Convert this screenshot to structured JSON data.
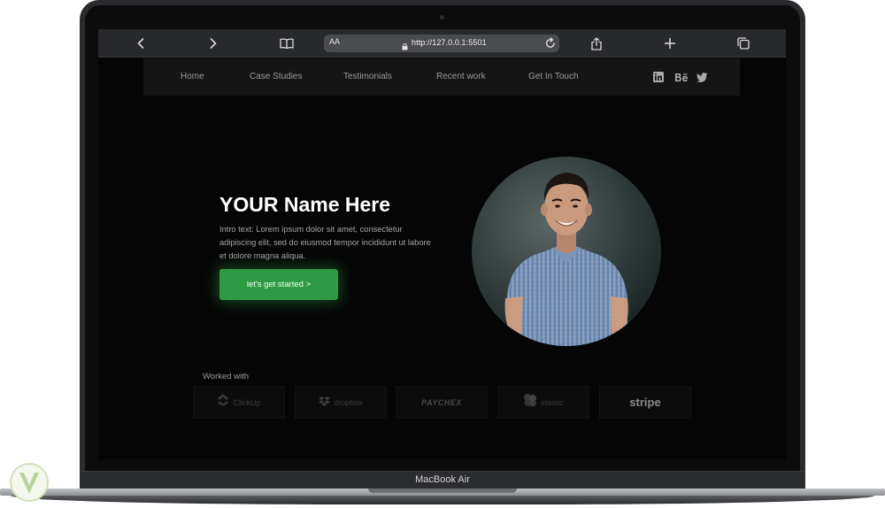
{
  "browser": {
    "url": "http://127.0.0.1:5501",
    "text_size_label": "AA",
    "icons": [
      "chevron-left-icon",
      "chevron-right-icon",
      "book-icon",
      "lock-icon",
      "reload-icon",
      "share-icon",
      "plus-icon",
      "tabs-icon"
    ]
  },
  "nav": {
    "links": [
      "Home",
      "Case Studies",
      "Testimonials",
      "Recent work",
      "Get In Touch"
    ],
    "social_icons": [
      "linkedin-icon",
      "behance-icon",
      "twitter-icon"
    ]
  },
  "hero": {
    "title": "YOUR Name Here",
    "intro": "Intro text: Lorem ipsum dolor sit amet, consectetur adipiscing elit, sed do eiusmod tempor incididunt ut labore et dolore magna aliqua.",
    "cta_label": "let's get started >"
  },
  "worked_with": {
    "label": "Worked with",
    "logos": [
      "ClickUp",
      "dropbox",
      "PAYCHEX",
      "elastic",
      "stripe"
    ]
  },
  "device": {
    "label": "MacBook Air"
  },
  "colors": {
    "accent": "#2e9a43",
    "page_bg": "#050505",
    "nav_bg": "#151515"
  }
}
